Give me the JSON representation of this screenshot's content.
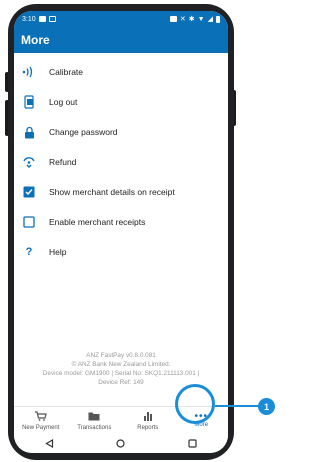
{
  "status_bar": {
    "time": "3:10"
  },
  "app_bar": {
    "title": "More"
  },
  "menu": {
    "items": [
      {
        "label": "Calibrate",
        "icon": "calibrate-icon"
      },
      {
        "label": "Log out",
        "icon": "logout-icon"
      },
      {
        "label": "Change password",
        "icon": "lock-icon"
      },
      {
        "label": "Refund",
        "icon": "refund-icon"
      },
      {
        "label": "Show merchant details on receipt",
        "icon": "checkbox-checked",
        "checked": true
      },
      {
        "label": "Enable merchant receipts",
        "icon": "checkbox-unchecked",
        "checked": false
      },
      {
        "label": "Help",
        "icon": "help-icon"
      }
    ]
  },
  "footer": {
    "app_version": "ANZ FastPay v0.8.0.081",
    "copyright": "© ANZ Bank New Zealand Limited.",
    "device_info": "Device model: GM1900 | Serial No: SKQ1.211113.001 |",
    "device_ref": "Device Ref: 149"
  },
  "bottom_nav": {
    "new_payment": "New Payment",
    "transactions": "Transactions",
    "reports": "Reports",
    "more": "More"
  },
  "callout": {
    "number": "1"
  },
  "colors": {
    "primary": "#0a70b8",
    "callout": "#1a8dd8"
  }
}
